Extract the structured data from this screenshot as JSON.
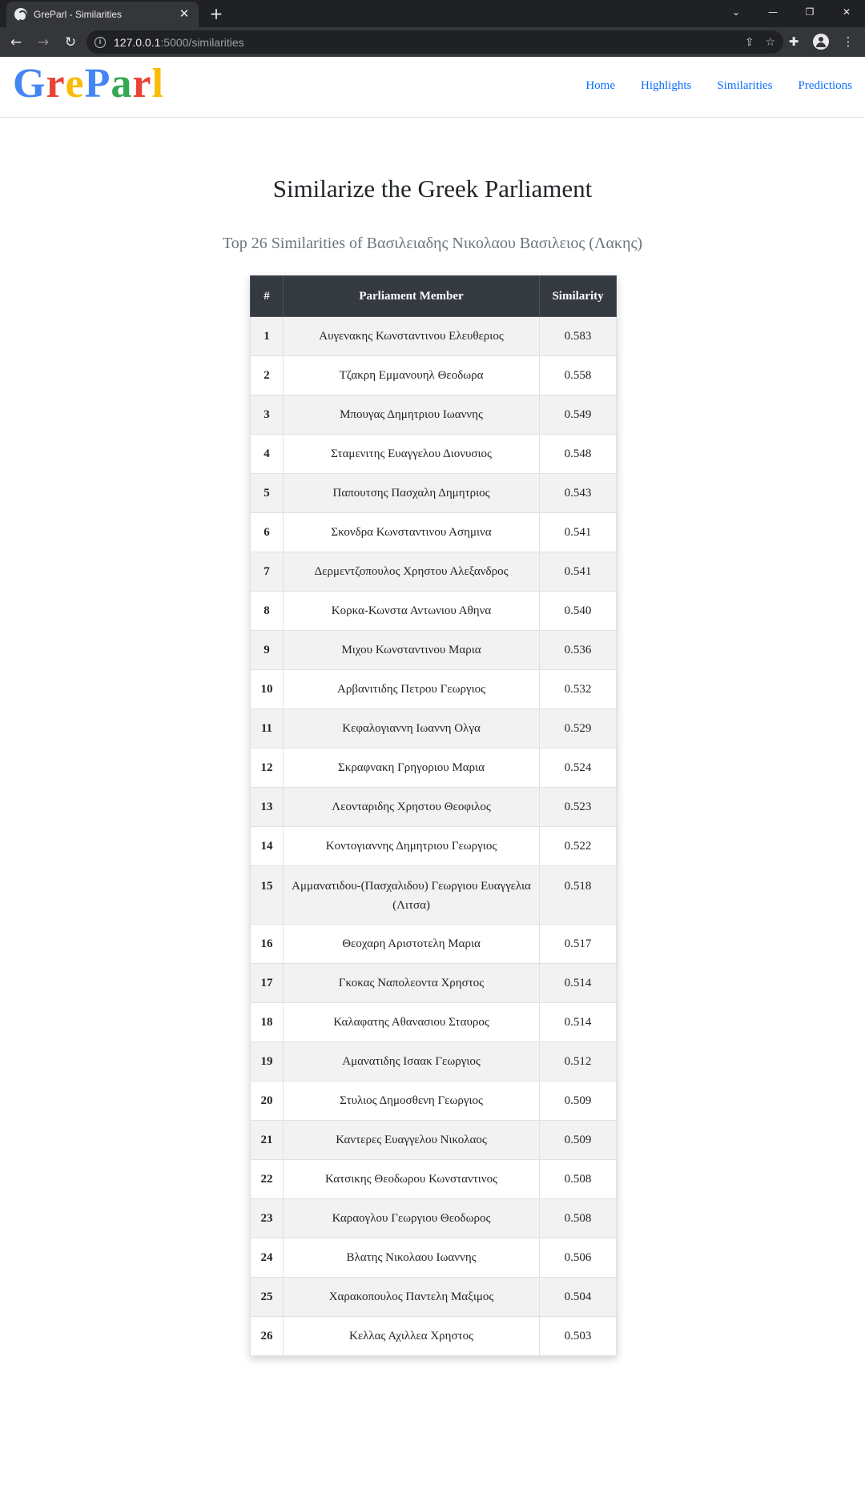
{
  "browser": {
    "tab_title": "GreParl - Similarities",
    "url_host": "127.0.0.1",
    "url_path": ":5000/similarities"
  },
  "site": {
    "brand": [
      "G",
      "r",
      "e",
      "P",
      "a",
      "r",
      "l"
    ],
    "brand_colors": [
      "#4285F4",
      "#EA4335",
      "#FBBC05",
      "#4285F4",
      "#34A853",
      "#EA4335",
      "#FBBC05"
    ],
    "nav": [
      "Home",
      "Highlights",
      "Similarities",
      "Predictions"
    ],
    "link_color": "#0d6efd"
  },
  "page": {
    "title": "Similarize the Greek Parliament",
    "subtitle": "Top 26 Similarities of Βασιλειαδης Νικολαου Βασιλειος (Λακης)"
  },
  "table": {
    "headers": [
      "#",
      "Parliament Member",
      "Similarity"
    ],
    "rows": [
      {
        "rank": "1",
        "member": "Αυγενακης Κωνσταντινου Ελευθεριος",
        "similarity": "0.583"
      },
      {
        "rank": "2",
        "member": "Τζακρη Εμμανουηλ Θεοδωρα",
        "similarity": "0.558"
      },
      {
        "rank": "3",
        "member": "Μπουγας Δημητριου Ιωαννης",
        "similarity": "0.549"
      },
      {
        "rank": "4",
        "member": "Σταμενιτης Ευαγγελου Διονυσιος",
        "similarity": "0.548"
      },
      {
        "rank": "5",
        "member": "Παπουτσης Πασχαλη Δημητριος",
        "similarity": "0.543"
      },
      {
        "rank": "6",
        "member": "Σκονδρα Κωνσταντινου Ασημινα",
        "similarity": "0.541"
      },
      {
        "rank": "7",
        "member": "Δερμεντζοπουλος Χρηστου Αλεξανδρος",
        "similarity": "0.541"
      },
      {
        "rank": "8",
        "member": "Κορκα-Κωνστα Αντωνιου Αθηνα",
        "similarity": "0.540"
      },
      {
        "rank": "9",
        "member": "Μιχου Κωνσταντινου Μαρια",
        "similarity": "0.536"
      },
      {
        "rank": "10",
        "member": "Αρβανιτιδης Πετρου Γεωργιος",
        "similarity": "0.532"
      },
      {
        "rank": "11",
        "member": "Κεφαλογιαννη Ιωαννη Ολγα",
        "similarity": "0.529"
      },
      {
        "rank": "12",
        "member": "Σκραφνακη Γρηγοριου Μαρια",
        "similarity": "0.524"
      },
      {
        "rank": "13",
        "member": "Λεονταριδης Χρηστου Θεοφιλος",
        "similarity": "0.523"
      },
      {
        "rank": "14",
        "member": "Κοντογιαννης Δημητριου Γεωργιος",
        "similarity": "0.522"
      },
      {
        "rank": "15",
        "member": "Αμμανατιδου-(Πασχαλιδου) Γεωργιου Ευαγγελια (Λιτσα)",
        "similarity": "0.518"
      },
      {
        "rank": "16",
        "member": "Θεοχαρη Αριστοτελη Μαρια",
        "similarity": "0.517"
      },
      {
        "rank": "17",
        "member": "Γκοκας Ναπολεοντα Χρηστος",
        "similarity": "0.514"
      },
      {
        "rank": "18",
        "member": "Καλαφατης Αθανασιου Σταυρος",
        "similarity": "0.514"
      },
      {
        "rank": "19",
        "member": "Αμανατιδης Ισαακ Γεωργιος",
        "similarity": "0.512"
      },
      {
        "rank": "20",
        "member": "Στυλιος Δημοσθενη Γεωργιος",
        "similarity": "0.509"
      },
      {
        "rank": "21",
        "member": "Καντερες Ευαγγελου Νικολαος",
        "similarity": "0.509"
      },
      {
        "rank": "22",
        "member": "Κατσικης Θεοδωρου Κωνσταντινος",
        "similarity": "0.508"
      },
      {
        "rank": "23",
        "member": "Καραογλου Γεωργιου Θεοδωρος",
        "similarity": "0.508"
      },
      {
        "rank": "24",
        "member": "Βλατης Νικολαου Ιωαννης",
        "similarity": "0.506"
      },
      {
        "rank": "25",
        "member": "Χαρακοπουλος Παντελη Μαξιμος",
        "similarity": "0.504"
      },
      {
        "rank": "26",
        "member": "Κελλας Αχιλλεα Χρηστος",
        "similarity": "0.503"
      }
    ]
  }
}
